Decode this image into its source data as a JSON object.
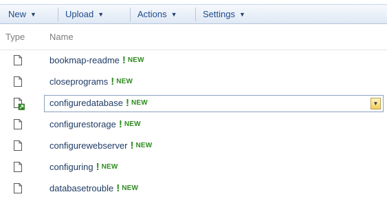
{
  "toolbar": {
    "new_label": "New",
    "upload_label": "Upload",
    "actions_label": "Actions",
    "settings_label": "Settings"
  },
  "columns": {
    "type": "Type",
    "name": "Name"
  },
  "badge": {
    "mark": "!",
    "label": "NEW"
  },
  "rows": [
    {
      "name": "bookmap-readme",
      "icon": "document-icon"
    },
    {
      "name": "closeprograms",
      "icon": "document-icon"
    },
    {
      "name": "configuredatabase",
      "icon": "document-checked-out-icon"
    },
    {
      "name": "configurestorage",
      "icon": "document-icon"
    },
    {
      "name": "configurewebserver",
      "icon": "document-icon"
    },
    {
      "name": "configuring",
      "icon": "document-icon"
    },
    {
      "name": "databasetrouble",
      "icon": "document-icon"
    }
  ],
  "colors": {
    "link": "#1f3b66",
    "new_badge": "#2e8b1f",
    "toolbar": "#dfe8f4"
  }
}
